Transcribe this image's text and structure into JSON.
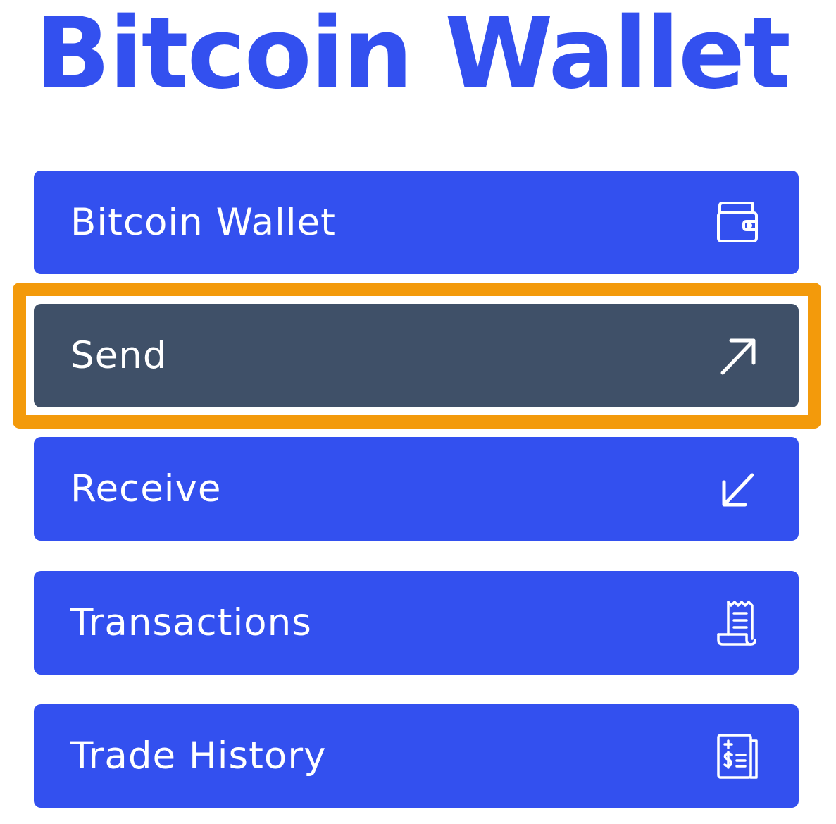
{
  "page": {
    "title": "Bitcoin Wallet"
  },
  "menu": {
    "items": [
      {
        "label": "Bitcoin Wallet",
        "icon": "wallet-icon",
        "selected": false
      },
      {
        "label": "Send",
        "icon": "arrow-up-right-icon",
        "selected": true
      },
      {
        "label": "Receive",
        "icon": "arrow-down-left-icon",
        "selected": false
      },
      {
        "label": "Transactions",
        "icon": "receipt-icon",
        "selected": false
      },
      {
        "label": "Trade History",
        "icon": "trade-history-icon",
        "selected": false
      }
    ]
  },
  "colors": {
    "brand_blue": "#3350ef",
    "selected_item": "#3f5068",
    "highlight": "#f39a0b",
    "text_on_button": "#ffffff"
  }
}
